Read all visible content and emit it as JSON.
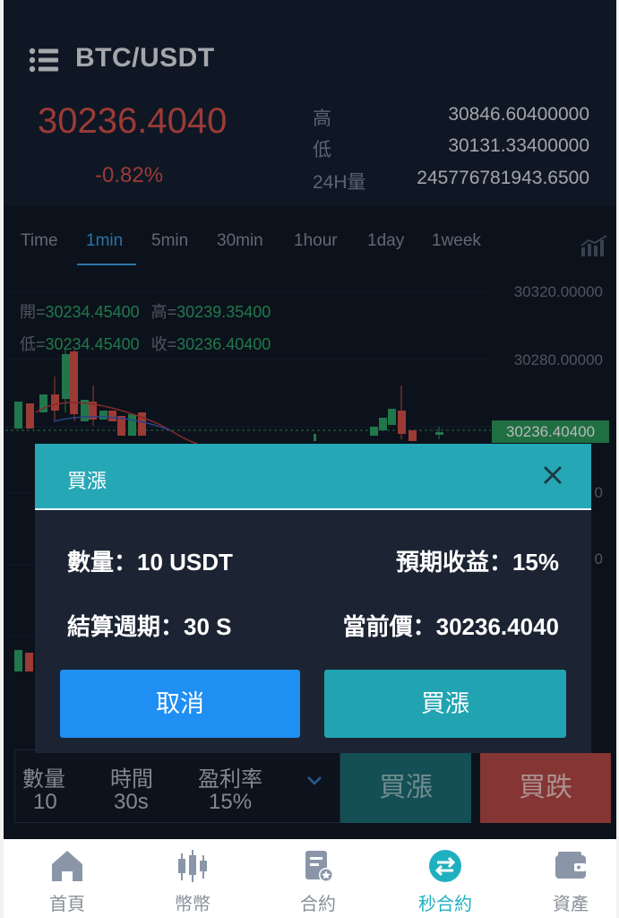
{
  "header": {
    "pair": "BTC/USDT",
    "price": "30236.4040",
    "change": "-0.82%",
    "stats": [
      {
        "label": "高",
        "value": "30846.60400000"
      },
      {
        "label": "低",
        "value": "30131.33400000"
      },
      {
        "label": "24H量",
        "value": "245776781943.6500"
      }
    ]
  },
  "tabs": [
    "Time",
    "1min",
    "5min",
    "30min",
    "1hour",
    "1day",
    "1week"
  ],
  "active_tab": "1min",
  "ohlc": {
    "open_label": "開=",
    "open": "30234.45400",
    "high_label": "高=",
    "high": "30239.35400",
    "low_label": "低=",
    "low": "30234.45400",
    "close_label": "收=",
    "close": "30236.40400"
  },
  "axis": {
    "labels": [
      "30320.00000",
      "30280.00000"
    ],
    "current": "30236.40400",
    "partial": [
      "0",
      "0"
    ]
  },
  "modal": {
    "title": "買漲",
    "quantity": "數量：10 USDT",
    "expected": "預期收益：15%",
    "period": "結算週期：30 S",
    "current_price": "當前價：30236.4040",
    "cancel": "取消",
    "confirm": "買漲"
  },
  "order": {
    "qty_label": "數量",
    "qty": "10",
    "time_label": "時間",
    "time": "30s",
    "rate_label": "盈利率",
    "rate": "15%",
    "buy_up": "買漲",
    "buy_down": "買跌"
  },
  "nav": [
    "首頁",
    "幣幣",
    "合約",
    "秒合約",
    "資產"
  ],
  "nav_active": "秒合約",
  "colors": {
    "up": "#2fa66a",
    "down": "#d8514c",
    "accent": "#26a7b6",
    "cancel": "#1f8ff4"
  }
}
